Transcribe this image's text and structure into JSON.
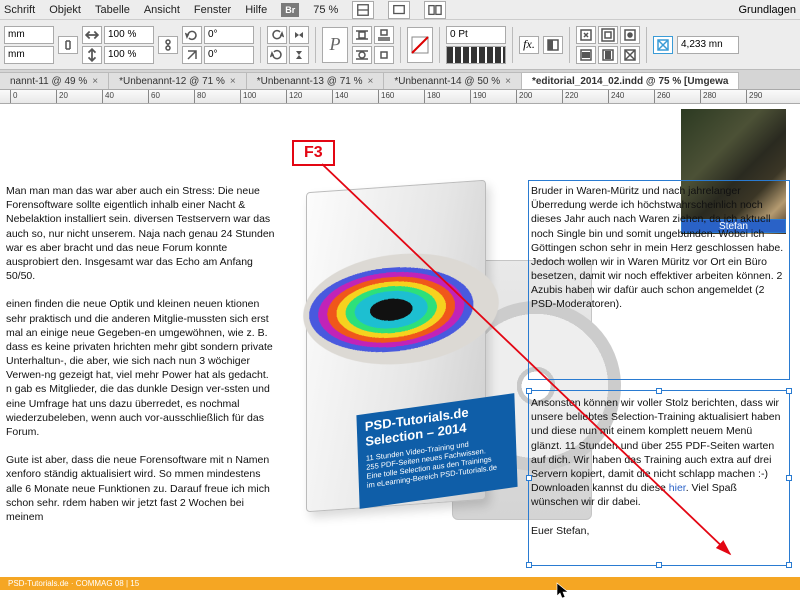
{
  "menu": {
    "items": [
      "Schrift",
      "Objekt",
      "Tabelle",
      "Ansicht",
      "Fenster",
      "Hilfe"
    ],
    "right_label": "Grundlagen",
    "zoom": "75 %"
  },
  "toolbar": {
    "x_unit": "mm",
    "w_unit": "mm",
    "scale_1": "100 %",
    "scale_2": "100 %",
    "angle_1": "0°",
    "angle_2": "0°",
    "stroke_pt": "0 Pt",
    "measure": "4,233 mn"
  },
  "tabs": [
    {
      "label": "nannt-11 @ 49 %",
      "close": true
    },
    {
      "label": "*Unbenannt-12 @ 71 %",
      "close": true
    },
    {
      "label": "*Unbenannt-13 @ 71 %",
      "close": true
    },
    {
      "label": "*Unbenannt-14 @ 50 %",
      "close": true
    },
    {
      "label": "*editorial_2014_02.indd @ 75 % [Umgewa",
      "close": false,
      "active": true
    }
  ],
  "ruler": [
    "0",
    "20",
    "40",
    "60",
    "80",
    "100",
    "120",
    "140",
    "160",
    "180",
    "190",
    "200",
    "220",
    "240",
    "260",
    "280",
    "290"
  ],
  "col_left_p1": "Man man man das war aber auch ein Stress: Die neue Forensoftware sollte eigentlich inhalb einer Nacht & Nebelaktion installiert sein. diversen Testservern war das auch so, nur nicht unserem. Naja nach genau 24 Stunden war es aber bracht und das neue Forum konnte ausprobiert den. Insgesamt war das Echo am Anfang 50/50.",
  "col_left_p2": "einen finden die neue Optik und kleinen neuen ktionen sehr praktisch und die anderen Mitglie-mussten sich erst mal an einige neue Gegeben-en umgewöhnen, wie z. B. dass es keine privaten hrichten mehr gibt sondern private Unterhaltun-, die aber, wie sich nach nun 3 wöchiger Verwen-ng gezeigt hat, viel mehr Power hat als gedacht. n gab es Mitglieder, die das dunkle Design ver-ssten und eine Umfrage hat uns dazu überredet, es nochmal wiederzubeleben, wenn auch vor-ausschließlich für das Forum.",
  "col_left_p3": "Gute ist aber, dass die neue Forensoftware mit n Namen xenforo ständig aktualisiert wird. So mmen mindestens alle 6 Monate neue Funktionen zu. Darauf freue ich mich schon sehr. rdem haben wir jetzt fast 2 Wochen bei meinem",
  "photo_caption": "Stefan",
  "col_right_p1": "Bruder in Waren-Müritz und nach jahrelanger Überredung werde ich höchstwahrscheinlich noch dieses Jahr auch nach Waren ziehen, da ich aktuell noch Single bin und somit ungebunden. Wobei ich Göttingen schon sehr in mein Herz geschlossen habe. Jedoch wollen wir in Waren Müritz vor Ort ein Büro besetzen, damit wir noch effektiver arbeiten können. 2 Azubis haben wir dafür auch schon angemeldet (2 PSD-Moderatoren).",
  "col_right_p2a": "Ansonsten können wir voller Stolz berichten, dass wir unsere beliebtes Selection-Training aktualisiert haben und diese nun mit einem komplett neuem Menü glänzt. 11 Stunden und über 255 PDF-Seiten warten auf dich. Wir haben das Training auch extra auf drei Servern kopiert, damit die nicht schlapp machen :-) Downloaden kannst du diese ",
  "col_right_link": "hier",
  "col_right_p2b": ". Viel Spaß wünschen wir dir dabei.",
  "col_right_sign": "Euer  Stefan,",
  "dvd": {
    "brand": "PSD-Tutorials.de",
    "title": "Selection – 2014",
    "sub1": "11 Stunden Video-Training und",
    "sub2": "255 PDF-Seiten neues Fachwissen.",
    "sub3": "Eine tolle Selection aus den Trainings",
    "sub4": "im eLearning-Bereich PSD-Tutorials.de"
  },
  "orange_bar": "PSD-Tutorials.de · COMMAG 08 | 15",
  "annotation": "F3"
}
